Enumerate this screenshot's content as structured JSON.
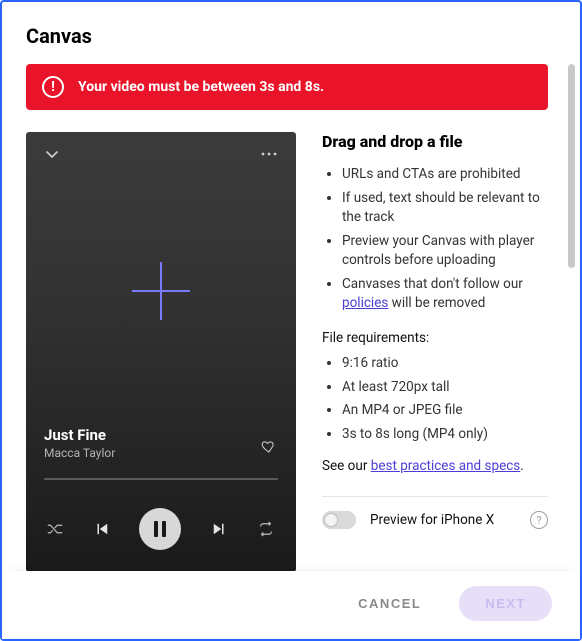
{
  "title": "Canvas",
  "alert": {
    "message": "Your video must be between 3s and 8s."
  },
  "preview": {
    "track_title": "Just Fine",
    "track_artist": "Macca Taylor"
  },
  "side": {
    "heading": "Drag and drop a file",
    "guidelines": [
      "URLs and CTAs are prohibited",
      "If used, text should be relevant to the track",
      "Preview your Canvas with player controls before uploading",
      {
        "prefix": "Canvases that don't follow our ",
        "link": "policies",
        "suffix": " will be removed"
      }
    ],
    "requirements_label": "File requirements:",
    "requirements": [
      "9:16 ratio",
      "At least 720px tall",
      "An MP4 or JPEG file",
      "3s to 8s long (MP4 only)"
    ],
    "seeour_prefix": "See our ",
    "seeour_link": "best practices and specs",
    "seeour_suffix": ".",
    "toggle_label": "Preview for iPhone X"
  },
  "footer": {
    "cancel": "CANCEL",
    "next": "NEXT"
  }
}
